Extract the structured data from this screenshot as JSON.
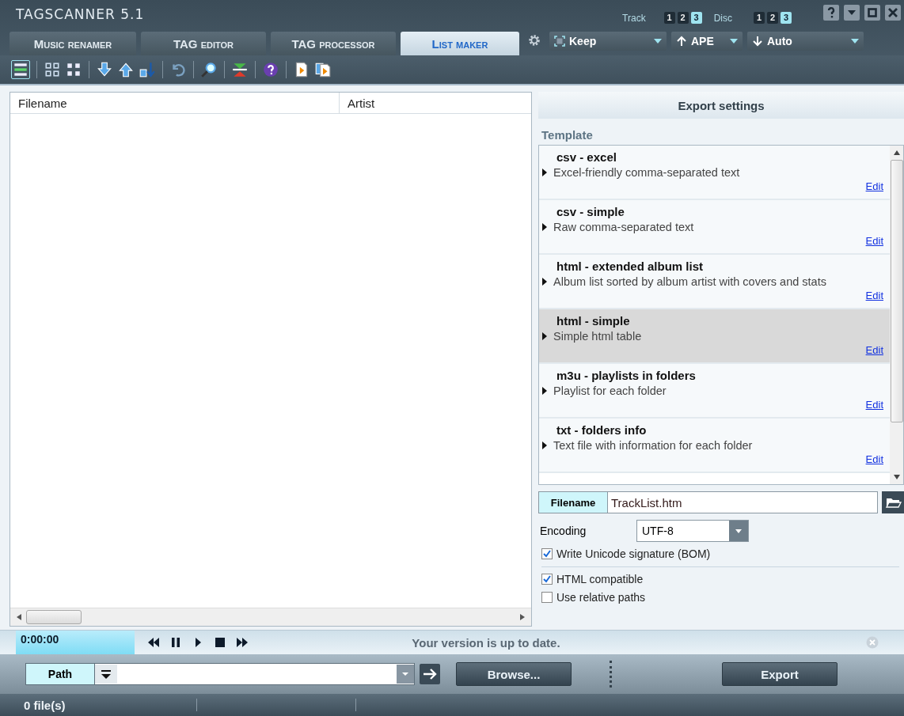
{
  "window": {
    "title": "TAGSCANNER 5.1"
  },
  "tabs": [
    {
      "label": "Music renamer",
      "selected": false
    },
    {
      "label": "TAG editor",
      "selected": false
    },
    {
      "label": "TAG processor",
      "selected": false
    },
    {
      "label": "List maker",
      "selected": true
    }
  ],
  "track_selector": {
    "label": "Track",
    "options": [
      {
        "label": "1",
        "selected": false
      },
      {
        "label": "2",
        "selected": false
      },
      {
        "label": "3",
        "selected": true
      }
    ]
  },
  "disc_selector": {
    "label": "Disc",
    "options": [
      {
        "label": "1",
        "selected": false
      },
      {
        "label": "2",
        "selected": false
      },
      {
        "label": "3",
        "selected": true
      }
    ]
  },
  "dropdowns": [
    {
      "kind": "keep",
      "value": "Keep"
    },
    {
      "kind": "up",
      "value": "APE"
    },
    {
      "kind": "down",
      "value": "Auto"
    }
  ],
  "file_list": {
    "columns": [
      "Filename",
      "Artist"
    ]
  },
  "export_settings": {
    "title": "Export settings",
    "template_label": "Template",
    "templates": [
      {
        "name": "csv - excel",
        "description": "Excel-friendly comma-separated text",
        "edit": "Edit",
        "selected": false
      },
      {
        "name": "csv - simple",
        "description": "Raw comma-separated text",
        "edit": "Edit",
        "selected": false
      },
      {
        "name": "html - extended album list",
        "description": "Album list sorted by album artist with covers and stats",
        "edit": "Edit",
        "selected": false
      },
      {
        "name": "html - simple",
        "description": "Simple html table",
        "edit": "Edit",
        "selected": true
      },
      {
        "name": "m3u - playlists in folders",
        "description": "Playlist for each folder",
        "edit": "Edit",
        "selected": false
      },
      {
        "name": "txt - folders info",
        "description": "Text file with information for each folder",
        "edit": "Edit",
        "selected": false
      }
    ],
    "filename_label": "Filename",
    "filename": "TrackList.htm",
    "encoding_label": "Encoding",
    "encoding": "UTF-8",
    "options": [
      {
        "label": "Write Unicode signature (BOM)",
        "checked": true
      },
      {
        "label": "HTML compatible",
        "checked": true
      },
      {
        "label": "Use relative paths",
        "checked": false
      }
    ]
  },
  "player": {
    "time": "0:00:00",
    "message": "Your version is up to date."
  },
  "path_bar": {
    "label": "Path",
    "browse": "Browse...",
    "export": "Export"
  },
  "status_bar": {
    "files": "0 file(s)"
  }
}
